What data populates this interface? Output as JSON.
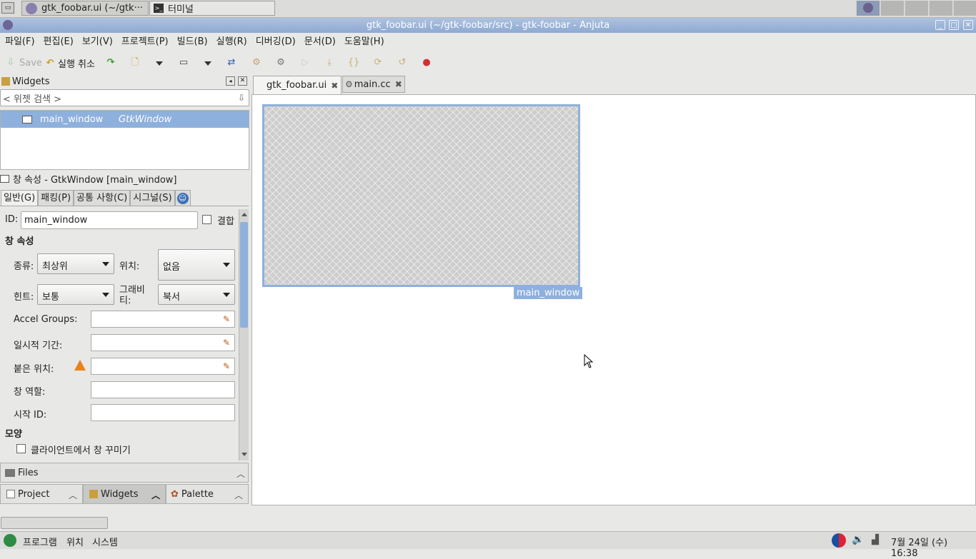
{
  "taskbar": {
    "tasks": [
      {
        "label": "gtk_foobar.ui (~/gtk···",
        "icon": "anjuta-icon"
      },
      {
        "label": "터미널",
        "icon": "terminal-icon"
      }
    ]
  },
  "window": {
    "title": "gtk_foobar.ui (~/gtk-foobar/src) - gtk-foobar - Anjuta"
  },
  "menubar": {
    "items": [
      "파일(F)",
      "편집(E)",
      "보기(V)",
      "프로젝트(P)",
      "빌드(B)",
      "실행(R)",
      "디버깅(D)",
      "문서(D)",
      "도움말(H)"
    ]
  },
  "toolbar": {
    "save": "Save",
    "undo": "실행 취소"
  },
  "widgets_panel": {
    "title": "Widgets",
    "search_placeholder": "< 위젯 검색 >",
    "tree": [
      {
        "name": "main_window",
        "type": "GtkWindow"
      }
    ]
  },
  "properties": {
    "header": "창 속성 - GtkWindow [main_window]",
    "tabs": [
      "일반(G)",
      "패킹(P)",
      "공통 사항(C)",
      "시그널(S)"
    ],
    "id_label": "ID:",
    "id_value": "main_window",
    "composite_label": "결합",
    "section_window": "창 속성",
    "type_label": "종류:",
    "type_value": "최상위",
    "position_label": "위치:",
    "position_value": "없음",
    "hint_label": "힌트:",
    "hint_value": "보통",
    "gravity_label": "그래비\n티:",
    "gravity_value": "북서",
    "accel_label": "Accel Groups:",
    "transient_label": "일시적 기간:",
    "attached_label": "붙은 위치:",
    "role_label": "창 역할:",
    "startup_label": "시작 ID:",
    "section_appearance": "모양",
    "client_decor_label": "클라이언트에서 창 꾸미기"
  },
  "bottom_panels": {
    "files": "Files",
    "project": "Project",
    "widgets": "Widgets",
    "palette": "Palette"
  },
  "editor_tabs": [
    {
      "label": "gtk_foobar.ui"
    },
    {
      "label": "main.cc"
    }
  ],
  "designer": {
    "widget_label": "main_window"
  },
  "panel": {
    "apps": "프로그램",
    "places": "위치",
    "system": "시스템",
    "clock": "7월 24일 (수) 16:38"
  },
  "colors": {
    "accent": "#8fb0de",
    "titlebar": "#9db6db"
  }
}
